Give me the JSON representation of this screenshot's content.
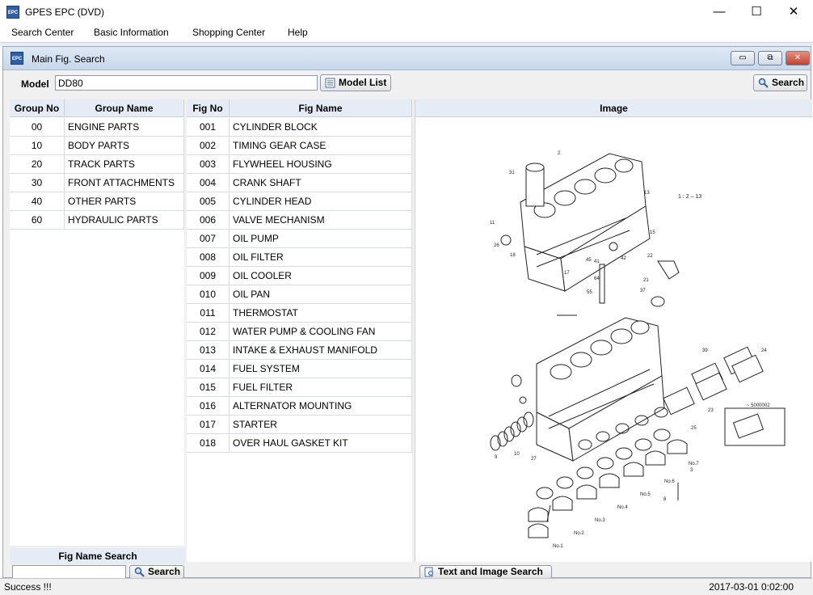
{
  "window": {
    "title": "GPES EPC (DVD)",
    "icon": "epc-app-icon",
    "icon_text": "EPC",
    "minimize": "—",
    "maximize": "☐",
    "close": "✕"
  },
  "menu": [
    "Search Center",
    "Basic Information",
    "Shopping Center",
    "Help"
  ],
  "child": {
    "title": "Main Fig. Search",
    "icon_text": "EPC",
    "minimize": "▭",
    "restore": "⧉",
    "close": "✕"
  },
  "model": {
    "label": "Model",
    "value": "DD80",
    "model_list_button": "Model List",
    "search_button": "Search"
  },
  "groups": {
    "headers": [
      "Group No",
      "Group Name"
    ],
    "rows": [
      [
        "00",
        "ENGINE PARTS"
      ],
      [
        "10",
        "BODY PARTS"
      ],
      [
        "20",
        "TRACK PARTS"
      ],
      [
        "30",
        "FRONT ATTACHMENTS"
      ],
      [
        "40",
        "OTHER PARTS"
      ],
      [
        "60",
        "HYDRAULIC PARTS"
      ]
    ]
  },
  "figs": {
    "headers": [
      "Fig No",
      "Fig Name"
    ],
    "rows": [
      [
        "001",
        "CYLINDER BLOCK"
      ],
      [
        "002",
        "TIMING GEAR CASE"
      ],
      [
        "003",
        "FLYWHEEL HOUSING"
      ],
      [
        "004",
        "CRANK SHAFT"
      ],
      [
        "005",
        "CYLINDER HEAD"
      ],
      [
        "006",
        "VALVE MECHANISM"
      ],
      [
        "007",
        "OIL PUMP"
      ],
      [
        "008",
        "OIL FILTER"
      ],
      [
        "009",
        "OIL COOLER"
      ],
      [
        "010",
        "OIL PAN"
      ],
      [
        "011",
        "THERMOSTAT"
      ],
      [
        "012",
        "WATER PUMP & COOLING FAN"
      ],
      [
        "013",
        "INTAKE & EXHAUST MANIFOLD"
      ],
      [
        "014",
        "FUEL SYSTEM"
      ],
      [
        "015",
        "FUEL FILTER"
      ],
      [
        "016",
        "ALTERNATOR MOUNTING"
      ],
      [
        "017",
        "STARTER"
      ],
      [
        "018",
        "OVER HAUL GASKET KIT"
      ]
    ]
  },
  "fig_name_search": {
    "header": "Fig Name Search",
    "button": "Search"
  },
  "image": {
    "header": "Image",
    "scale": "1 : 2 – 13",
    "text_image_search_button": "Text and Image Search",
    "callouts": [
      "31",
      "2",
      "13",
      "11",
      "26",
      "18",
      "45",
      "41",
      "42",
      "15",
      "22",
      "64",
      "21",
      "55",
      "37",
      "17",
      "39",
      "24",
      "23",
      "25",
      "No.7",
      "No.6",
      "No.5",
      "No.4",
      "No.3",
      "No.2",
      "No.1",
      "27",
      "9",
      "10",
      "8",
      "3",
      "5000002"
    ]
  },
  "status": {
    "left": "Success !!!",
    "right": "2017-03-01 0:02:00"
  }
}
